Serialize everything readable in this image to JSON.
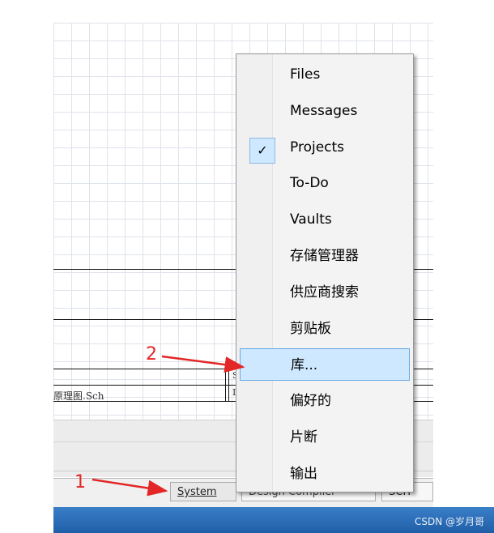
{
  "sheet": {
    "filename": "原理图.Sch",
    "block_letter_s": "S",
    "block_letter_l": "I"
  },
  "menu": {
    "items": [
      {
        "label": "Files",
        "checked": false,
        "highlighted": false
      },
      {
        "label": "Messages",
        "checked": false,
        "highlighted": false
      },
      {
        "label": "Projects",
        "checked": true,
        "highlighted": false
      },
      {
        "label": "To-Do",
        "checked": false,
        "highlighted": false
      },
      {
        "label": "Vaults",
        "checked": false,
        "highlighted": false
      },
      {
        "label": "存储管理器",
        "checked": false,
        "highlighted": false
      },
      {
        "label": "供应商搜索",
        "checked": false,
        "highlighted": false
      },
      {
        "label": "剪贴板",
        "checked": false,
        "highlighted": false
      },
      {
        "label": "库...",
        "checked": false,
        "highlighted": true
      },
      {
        "label": "偏好的",
        "checked": false,
        "highlighted": false
      },
      {
        "label": "片断",
        "checked": false,
        "highlighted": false
      },
      {
        "label": "输出",
        "checked": false,
        "highlighted": false
      }
    ],
    "check_glyph": "✓"
  },
  "status_bar": {
    "tabs": [
      "System",
      "Design Compiler",
      "SCH"
    ]
  },
  "annotations": {
    "one": "1",
    "two": "2"
  },
  "taskbar": {
    "watermark": "CSDN @岁月哥"
  },
  "colors": {
    "highlight": "#cde8ff",
    "annotation": "#e32626",
    "taskbar": "#2a6db8"
  }
}
